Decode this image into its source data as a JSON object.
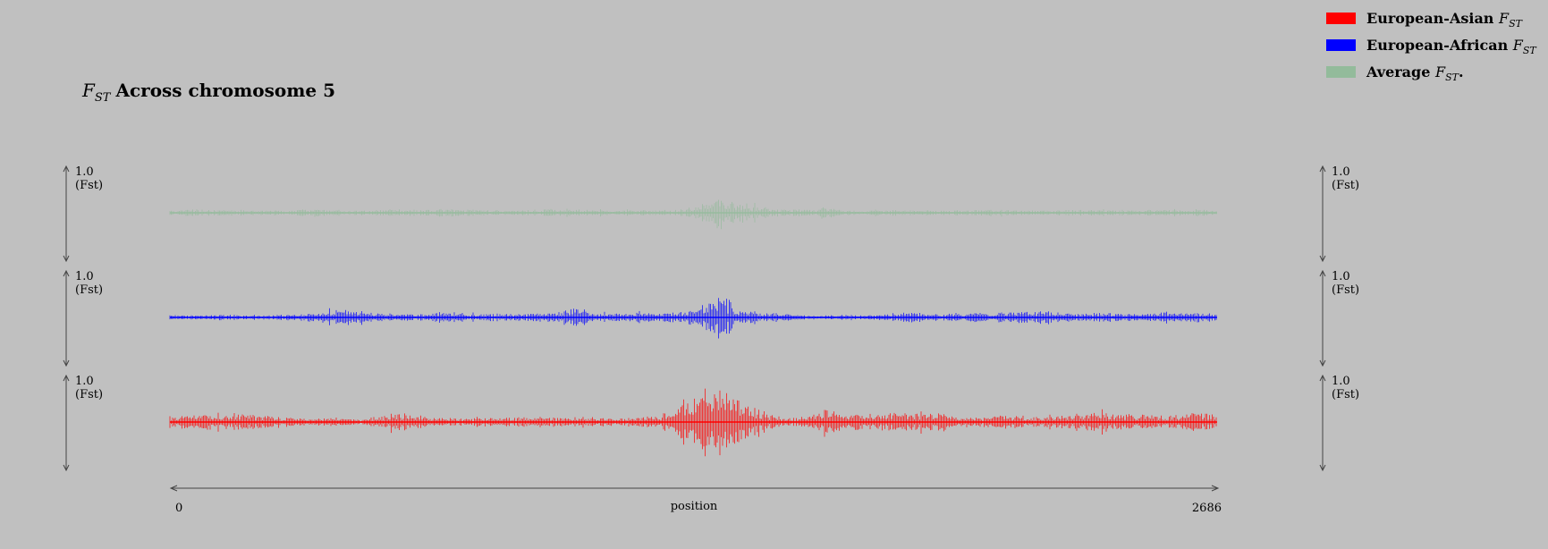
{
  "chart_data": {
    "type": "bar",
    "title": {
      "symbol": "F",
      "symbol_sub": "ST",
      "text": "Across chromosome 5"
    },
    "legend": {
      "placement": "top-right",
      "items": [
        {
          "label": "European-Asian",
          "symbol": "F",
          "symbol_sub": "ST",
          "suffix": "",
          "color": "#ff0000"
        },
        {
          "label": "European-African",
          "symbol": "F",
          "symbol_sub": "ST",
          "suffix": "",
          "color": "#0000ff"
        },
        {
          "label": "Average",
          "symbol": "F",
          "symbol_sub": "ST",
          "suffix": ".",
          "color": "#93bb9b"
        }
      ]
    },
    "xlabel": "position",
    "xlim": [
      0,
      2686
    ],
    "x_tick_labels": [
      "0",
      "2686"
    ],
    "y_axis": {
      "max_label": "1.0",
      "unit_label": "(Fst)",
      "ylim": [
        0,
        1.0
      ]
    },
    "grid": false,
    "tracks": [
      {
        "name": "Average",
        "color": "#93bb9b",
        "opacity": 0.9,
        "points": [
          [
            0,
            0.06
          ],
          [
            60,
            0.09
          ],
          [
            130,
            0.07
          ],
          [
            210,
            0.08
          ],
          [
            290,
            0.06
          ],
          [
            370,
            0.09
          ],
          [
            430,
            0.07
          ],
          [
            500,
            0.06
          ],
          [
            560,
            0.09
          ],
          [
            630,
            0.07
          ],
          [
            700,
            0.1
          ],
          [
            760,
            0.08
          ],
          [
            800,
            0.07
          ],
          [
            880,
            0.06
          ],
          [
            950,
            0.08
          ],
          [
            1000,
            0.1
          ],
          [
            1030,
            0.11
          ],
          [
            1060,
            0.09
          ],
          [
            1130,
            0.07
          ],
          [
            1200,
            0.06
          ],
          [
            1290,
            0.07
          ],
          [
            1330,
            0.11
          ],
          [
            1350,
            0.17
          ],
          [
            1360,
            0.22
          ],
          [
            1380,
            0.3
          ],
          [
            1390,
            0.36
          ],
          [
            1400,
            0.42
          ],
          [
            1410,
            0.48
          ],
          [
            1420,
            0.4
          ],
          [
            1430,
            0.32
          ],
          [
            1440,
            0.35
          ],
          [
            1450,
            0.29
          ],
          [
            1470,
            0.25
          ],
          [
            1500,
            0.2
          ],
          [
            1520,
            0.15
          ],
          [
            1550,
            0.1
          ],
          [
            1600,
            0.08
          ],
          [
            1650,
            0.07
          ],
          [
            1682,
            0.18
          ],
          [
            1720,
            0.07
          ],
          [
            1790,
            0.06
          ],
          [
            1850,
            0.08
          ],
          [
            1930,
            0.07
          ],
          [
            2010,
            0.06
          ],
          [
            2090,
            0.08
          ],
          [
            2180,
            0.07
          ],
          [
            2250,
            0.06
          ],
          [
            2330,
            0.08
          ],
          [
            2400,
            0.07
          ],
          [
            2480,
            0.06
          ],
          [
            2560,
            0.08
          ],
          [
            2620,
            0.09
          ],
          [
            2686,
            0.07
          ]
        ]
      },
      {
        "name": "European-African",
        "color": "#0000ff",
        "opacity": 1,
        "points": [
          [
            0,
            0.06
          ],
          [
            60,
            0.05
          ],
          [
            130,
            0.07
          ],
          [
            200,
            0.05
          ],
          [
            260,
            0.06
          ],
          [
            320,
            0.08
          ],
          [
            360,
            0.12
          ],
          [
            400,
            0.18
          ],
          [
            440,
            0.2
          ],
          [
            480,
            0.16
          ],
          [
            520,
            0.11
          ],
          [
            580,
            0.09
          ],
          [
            640,
            0.08
          ],
          [
            700,
            0.14
          ],
          [
            740,
            0.12
          ],
          [
            800,
            0.07
          ],
          [
            860,
            0.11
          ],
          [
            900,
            0.09
          ],
          [
            960,
            0.1
          ],
          [
            1000,
            0.14
          ],
          [
            1020,
            0.22
          ],
          [
            1050,
            0.28
          ],
          [
            1080,
            0.12
          ],
          [
            1150,
            0.1
          ],
          [
            1200,
            0.13
          ],
          [
            1260,
            0.11
          ],
          [
            1310,
            0.13
          ],
          [
            1340,
            0.2
          ],
          [
            1370,
            0.32
          ],
          [
            1390,
            0.44
          ],
          [
            1400,
            0.52
          ],
          [
            1410,
            0.6
          ],
          [
            1420,
            0.48
          ],
          [
            1430,
            0.42
          ],
          [
            1440,
            0.36
          ],
          [
            1460,
            0.25
          ],
          [
            1490,
            0.18
          ],
          [
            1520,
            0.12
          ],
          [
            1580,
            0.08
          ],
          [
            1640,
            0.06
          ],
          [
            1700,
            0.05
          ],
          [
            1760,
            0.07
          ],
          [
            1820,
            0.05
          ],
          [
            1870,
            0.14
          ],
          [
            1920,
            0.12
          ],
          [
            1980,
            0.08
          ],
          [
            2050,
            0.1
          ],
          [
            2100,
            0.11
          ],
          [
            2150,
            0.13
          ],
          [
            2200,
            0.16
          ],
          [
            2260,
            0.15
          ],
          [
            2320,
            0.1
          ],
          [
            2380,
            0.11
          ],
          [
            2440,
            0.09
          ],
          [
            2500,
            0.1
          ],
          [
            2560,
            0.12
          ],
          [
            2620,
            0.11
          ],
          [
            2686,
            0.1
          ]
        ]
      },
      {
        "name": "European-Asian",
        "color": "#ff0000",
        "opacity": 1,
        "points": [
          [
            0,
            0.14
          ],
          [
            60,
            0.2
          ],
          [
            110,
            0.18
          ],
          [
            170,
            0.2
          ],
          [
            230,
            0.17
          ],
          [
            280,
            0.12
          ],
          [
            340,
            0.1
          ],
          [
            400,
            0.09
          ],
          [
            460,
            0.08
          ],
          [
            500,
            0.08
          ],
          [
            560,
            0.18
          ],
          [
            600,
            0.22
          ],
          [
            660,
            0.12
          ],
          [
            720,
            0.1
          ],
          [
            780,
            0.11
          ],
          [
            840,
            0.09
          ],
          [
            900,
            0.12
          ],
          [
            960,
            0.1
          ],
          [
            1020,
            0.14
          ],
          [
            1080,
            0.12
          ],
          [
            1150,
            0.09
          ],
          [
            1200,
            0.1
          ],
          [
            1260,
            0.15
          ],
          [
            1300,
            0.42
          ],
          [
            1330,
            0.62
          ],
          [
            1360,
            0.7
          ],
          [
            1390,
            0.85
          ],
          [
            1410,
            0.9
          ],
          [
            1430,
            0.78
          ],
          [
            1450,
            0.6
          ],
          [
            1480,
            0.48
          ],
          [
            1510,
            0.3
          ],
          [
            1550,
            0.14
          ],
          [
            1600,
            0.1
          ],
          [
            1650,
            0.16
          ],
          [
            1682,
            0.4
          ],
          [
            1720,
            0.2
          ],
          [
            1780,
            0.18
          ],
          [
            1840,
            0.22
          ],
          [
            1900,
            0.2
          ],
          [
            1960,
            0.24
          ],
          [
            2020,
            0.12
          ],
          [
            2080,
            0.1
          ],
          [
            2150,
            0.18
          ],
          [
            2210,
            0.12
          ],
          [
            2270,
            0.16
          ],
          [
            2330,
            0.2
          ],
          [
            2390,
            0.24
          ],
          [
            2450,
            0.2
          ],
          [
            2510,
            0.16
          ],
          [
            2570,
            0.15
          ],
          [
            2630,
            0.22
          ],
          [
            2686,
            0.18
          ]
        ]
      }
    ]
  }
}
